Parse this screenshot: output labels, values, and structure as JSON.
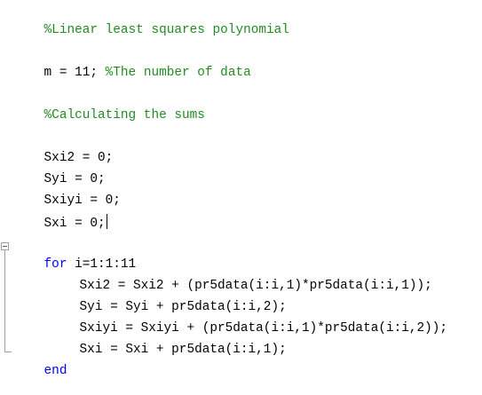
{
  "editor": {
    "lines": [
      "%Linear least squares polynomial",
      "",
      "m = 11; ",
      "%The number of data",
      "%Calculating the sums",
      "Sxi2 = 0;",
      "Syi = 0;",
      "Sxiyi = 0;",
      "Sxi = 0;",
      "for",
      " i=1:1:11",
      "Sxi2 = Sxi2 + (pr5data(i:i,1)*pr5data(i:i,1));",
      "Syi = Syi + pr5data(i:i,2);",
      "Sxiyi = Sxiyi + (pr5data(i:i,1)*pr5data(i:i,2));",
      "Sxi = Sxi + pr5data(i:i,1);",
      "end"
    ]
  },
  "colors": {
    "comment": "#228b22",
    "keyword": "#0000ff",
    "code": "#000000",
    "background": "#ffffff"
  },
  "icons": {
    "fold_toggle": "collapse-minus-icon"
  }
}
